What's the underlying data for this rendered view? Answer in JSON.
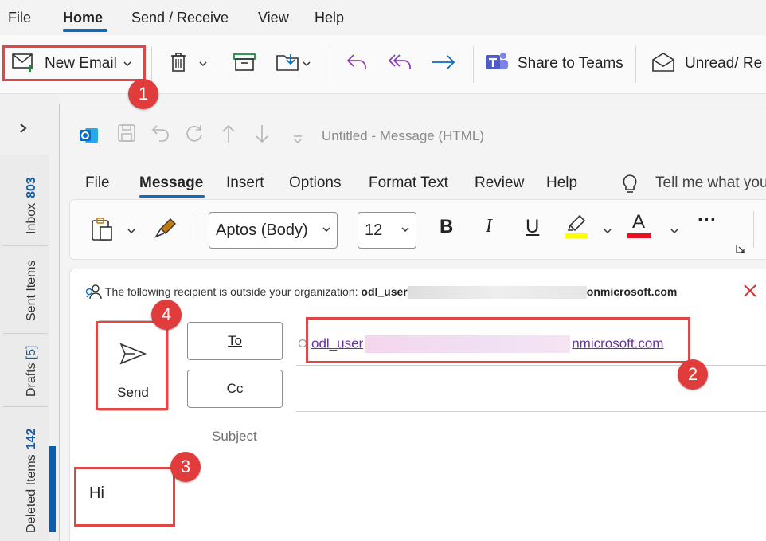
{
  "menu": {
    "file": "File",
    "home": "Home",
    "send_receive": "Send / Receive",
    "view": "View",
    "help": "Help"
  },
  "ribbon": {
    "new_email": "New Email",
    "share_to_teams": "Share to Teams",
    "unread_read": "Unread/ Re"
  },
  "nav": {
    "inbox": "Inbox",
    "inbox_count": "803",
    "sent_items": "Sent Items",
    "drafts": "Drafts",
    "drafts_count": "[5]",
    "deleted_items": "Deleted Items",
    "deleted_count": "142"
  },
  "compose": {
    "title": "Untitled  -  Message (HTML)",
    "tabs": [
      "File",
      "Message",
      "Insert",
      "Options",
      "Format Text",
      "Review",
      "Help"
    ],
    "tell_me": "Tell me what you",
    "font_name": "Aptos (Body)",
    "font_size": "12",
    "bold": "B",
    "italic": "I",
    "underline": "U",
    "font_color": "A",
    "more": "···",
    "warning_text": "The following recipient is outside your organization: ",
    "warning_user": "odl_user",
    "warning_domain": "onmicrosoft.com",
    "send_label": "Send",
    "to_label": "To",
    "cc_label": "Cc",
    "subject_label": "Subject",
    "recipient_prefix": "odl_user",
    "recipient_suffix": "nmicrosoft.com",
    "body_text": "Hi"
  },
  "annotations": [
    "1",
    "2",
    "3",
    "4"
  ],
  "colors": {
    "accent": "#0f6cbd",
    "highlight_box": "#e04848",
    "badge": "#e03c3c",
    "recipient_link": "#6b2fa0"
  }
}
